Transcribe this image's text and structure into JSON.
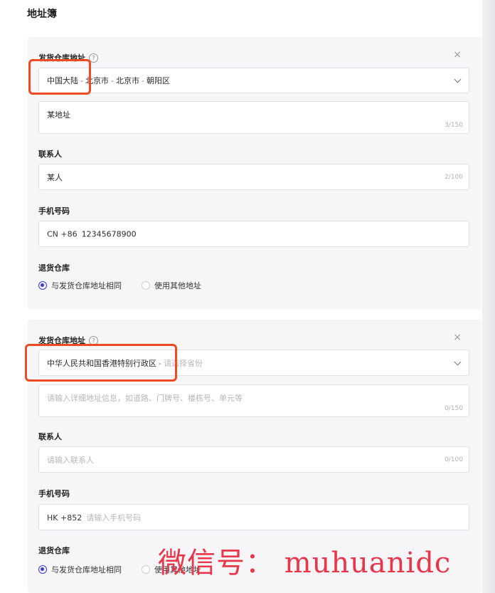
{
  "page": {
    "title": "地址簿"
  },
  "colors": {
    "accent": "#3d3ad1",
    "highlight": "#f04a23",
    "watermark": "#e8374a",
    "card_bg": "#f6f6f8"
  },
  "icons": {
    "help": "question-circle-icon",
    "close": "close-icon",
    "dropdown": "chevron-down-icon"
  },
  "cards": [
    {
      "warehouse_label": "发货仓库地址",
      "help_glyph": "?",
      "close_glyph": "×",
      "region": {
        "part1": "中国大陆",
        "part2": "北京市",
        "part3": "北京市",
        "part4": "朝阳区",
        "sep": "-"
      },
      "address": {
        "value": "某地址",
        "placeholder": "",
        "counter": "3/150"
      },
      "contact_label": "联系人",
      "contact": {
        "value": "某人",
        "counter": "2/100"
      },
      "phone_label": "手机号码",
      "phone": {
        "prefix": "CN +86",
        "value": "12345678900"
      },
      "return_label": "退货仓库",
      "return_options": [
        {
          "label": "与发货仓库地址相同",
          "selected": true
        },
        {
          "label": "使用其他地址",
          "selected": false
        }
      ]
    },
    {
      "warehouse_label": "发货仓库地址",
      "help_glyph": "?",
      "close_glyph": "×",
      "region": {
        "part1": "中华人民共和国香港特别行政区",
        "sep": "-",
        "placeholder": "请选择省份"
      },
      "address": {
        "placeholder": "请输入详细地址信息，如道路、门牌号、楼栋号、单元等",
        "counter": "0/150"
      },
      "contact_label": "联系人",
      "contact": {
        "placeholder": "请输入联系人",
        "counter": "0/100"
      },
      "phone_label": "手机号码",
      "phone": {
        "prefix": "HK +852",
        "placeholder": "请输入手机号码"
      },
      "return_label": "退货仓库",
      "return_options": [
        {
          "label": "与发货仓库地址相同",
          "selected": true
        },
        {
          "label": "使用其他地址",
          "selected": false
        }
      ]
    }
  ],
  "watermark": {
    "text": "微信号： muhuanidc"
  }
}
